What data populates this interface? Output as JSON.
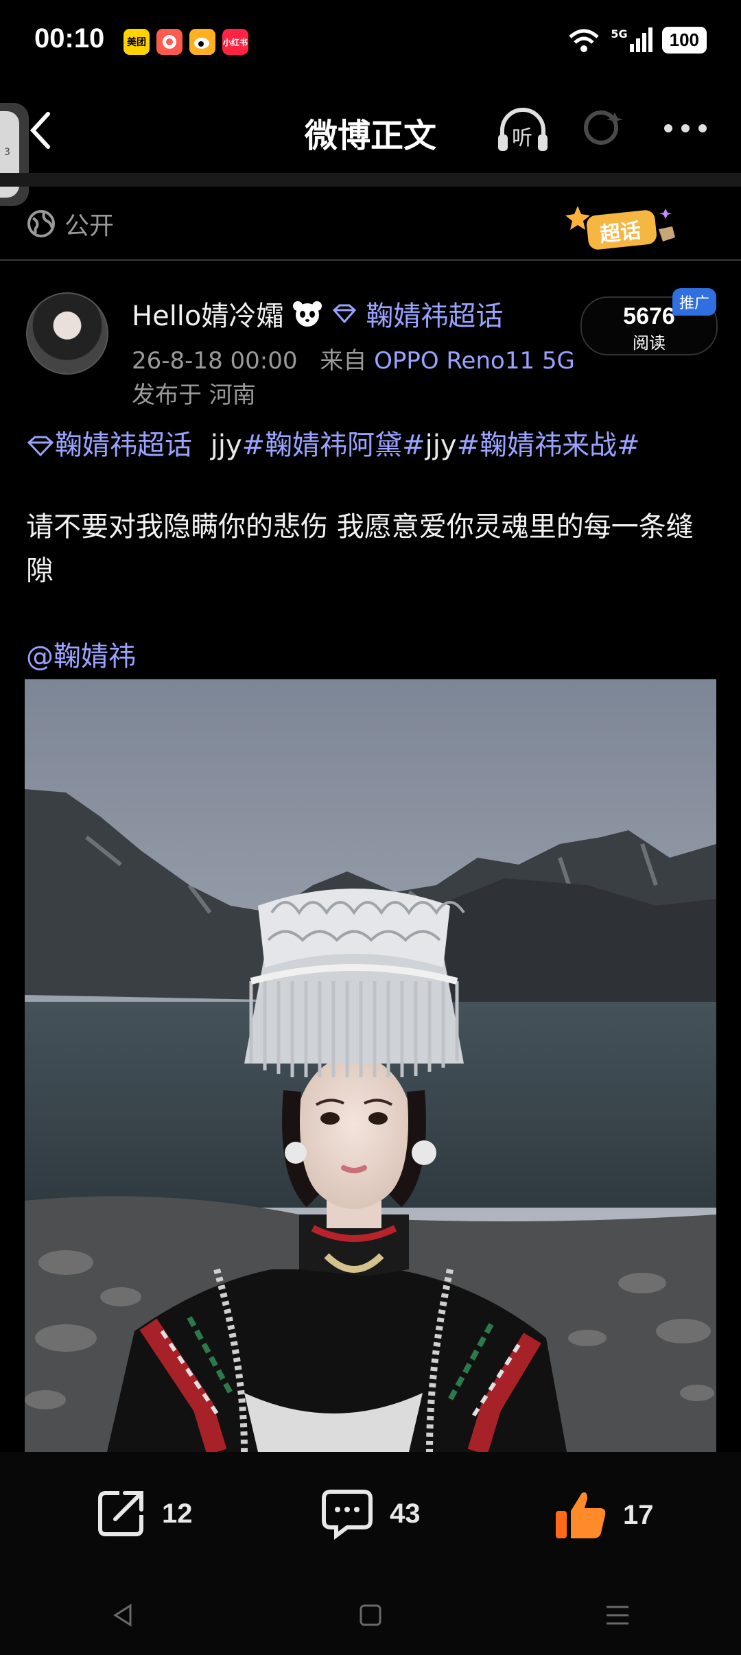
{
  "status_bar": {
    "time": "00:10",
    "apps": [
      {
        "label": "美团",
        "color": "#ffd200"
      },
      {
        "label": "",
        "color": "#ff5a4e"
      },
      {
        "label": "",
        "color": "#ffb020"
      },
      {
        "label": "小红书",
        "color": "#ff2442"
      }
    ],
    "network": "5G",
    "battery": "100"
  },
  "header": {
    "title": "微博正文",
    "listen_label": "听",
    "side_handle_number": "3"
  },
  "visibility": {
    "label": "公开"
  },
  "supertopic_badge": {
    "label": "超话"
  },
  "post": {
    "author_name": "Hello婧冷孀",
    "author_supertopic": "鞠婧祎超话",
    "date": "26-8-18 00:00",
    "source_prefix": "来自",
    "source_device": "OPPO Reno11 5G",
    "location": "发布于 河南",
    "reads_count": "5676",
    "reads_label": "阅读",
    "promo_tag": "推广",
    "tag_supertopic": "鞠婧祎超话",
    "tag_plain_1": "jjy",
    "tag_1": "#鞠婧祎阿黛#",
    "tag_plain_2": "jjy",
    "tag_2": "#鞠婧祎来战#",
    "text": "请不要对我隐瞒你的悲伤 我愿意爱你灵魂里的每一条缝隙",
    "mention": "@鞠婧祎"
  },
  "actions": {
    "reposts": "12",
    "comments": "43",
    "likes": "17"
  }
}
